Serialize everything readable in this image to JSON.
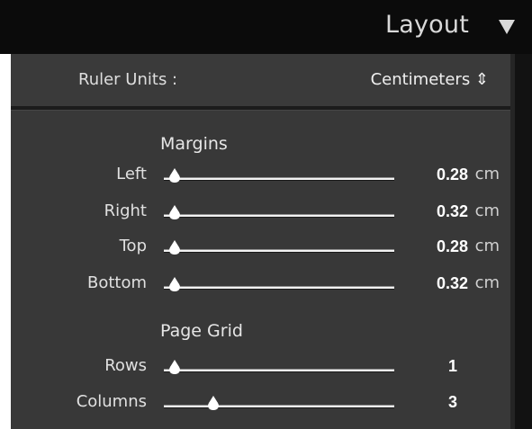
{
  "header": {
    "title": "Layout",
    "toggle_icon": "triangle-down-icon"
  },
  "ruler_units": {
    "label": "Ruler Units :",
    "value": "Centimeters",
    "stepper_icon": "updown-arrows-icon",
    "display": "Centimeters ⇕"
  },
  "sections": [
    {
      "heading": "Margins",
      "rows": [
        {
          "label": "Left",
          "value": "0.28",
          "unit": "cm",
          "fraction": 0.0
        },
        {
          "label": "Right",
          "value": "0.32",
          "unit": "cm",
          "fraction": 0.0
        },
        {
          "label": "Top",
          "value": "0.28",
          "unit": "cm",
          "fraction": 0.0
        },
        {
          "label": "Bottom",
          "value": "0.32",
          "unit": "cm",
          "fraction": 0.0
        }
      ]
    },
    {
      "heading": "Page Grid",
      "rows": [
        {
          "label": "Rows",
          "value": "1",
          "unit": "",
          "fraction": 0.0
        },
        {
          "label": "Columns",
          "value": "3",
          "unit": "",
          "fraction": 0.18
        }
      ]
    }
  ],
  "colors": {
    "header_bg": "#0b0b0b",
    "panel_bg": "#383838",
    "text": "#e0e0e0",
    "value_text": "#ffffff"
  }
}
